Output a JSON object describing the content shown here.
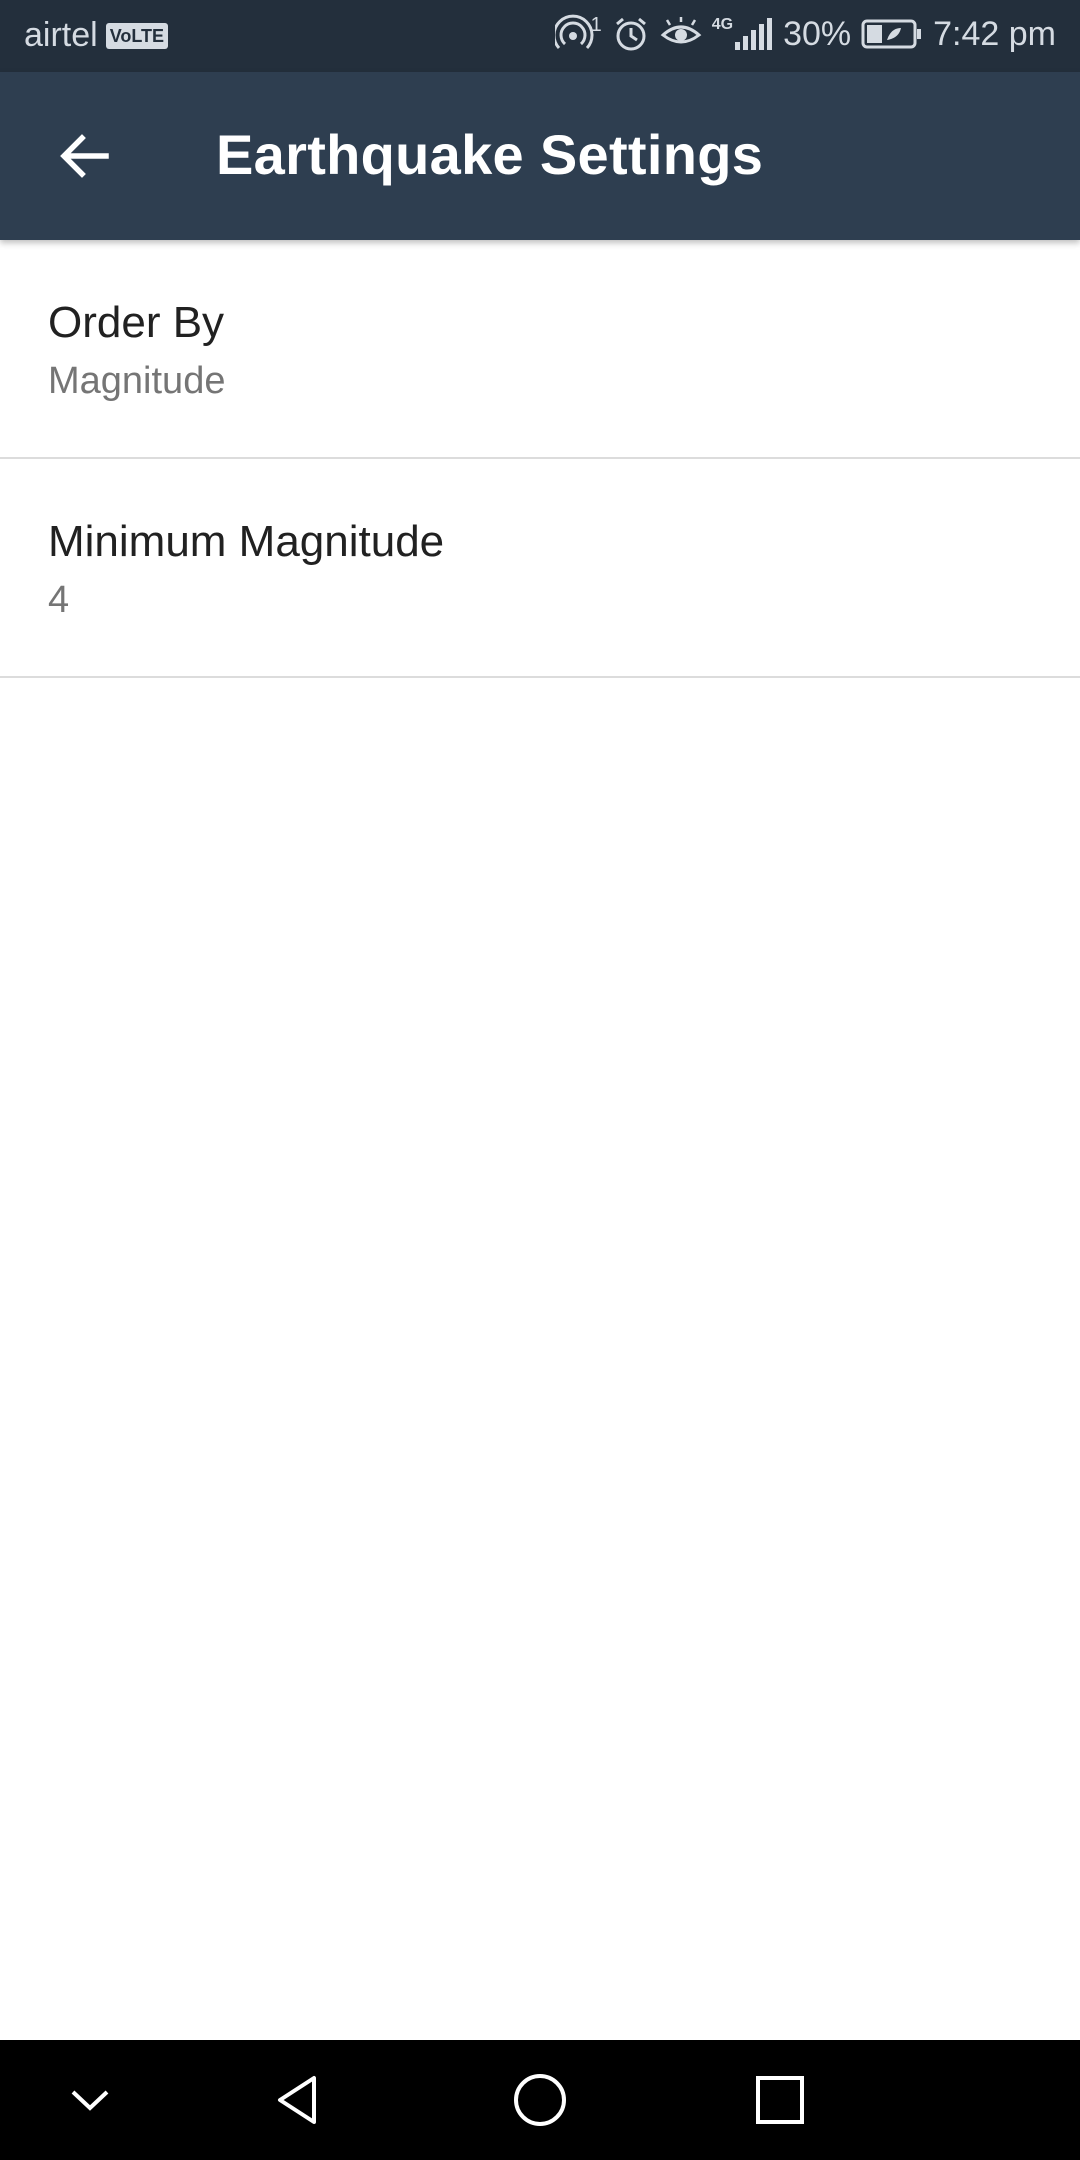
{
  "status_bar": {
    "carrier": "airtel",
    "volte": "VoLTE",
    "network": "4G",
    "hotspot_count": "1",
    "battery": "30%",
    "time": "7:42 pm"
  },
  "toolbar": {
    "title": "Earthquake Settings"
  },
  "preferences": [
    {
      "title": "Order By",
      "summary": "Magnitude"
    },
    {
      "title": "Minimum Magnitude",
      "summary": "4"
    }
  ],
  "colors": {
    "status_bar_bg": "#232f3c",
    "toolbar_bg": "#2e3e50",
    "nav_bar_bg": "#000000",
    "divider": "#dcdcdc"
  },
  "icons": {
    "back": "arrow-left-icon",
    "nav_collapse": "chevron-down-icon",
    "nav_back": "triangle-back-icon",
    "nav_home": "circle-home-icon",
    "nav_recents": "square-recents-icon"
  }
}
